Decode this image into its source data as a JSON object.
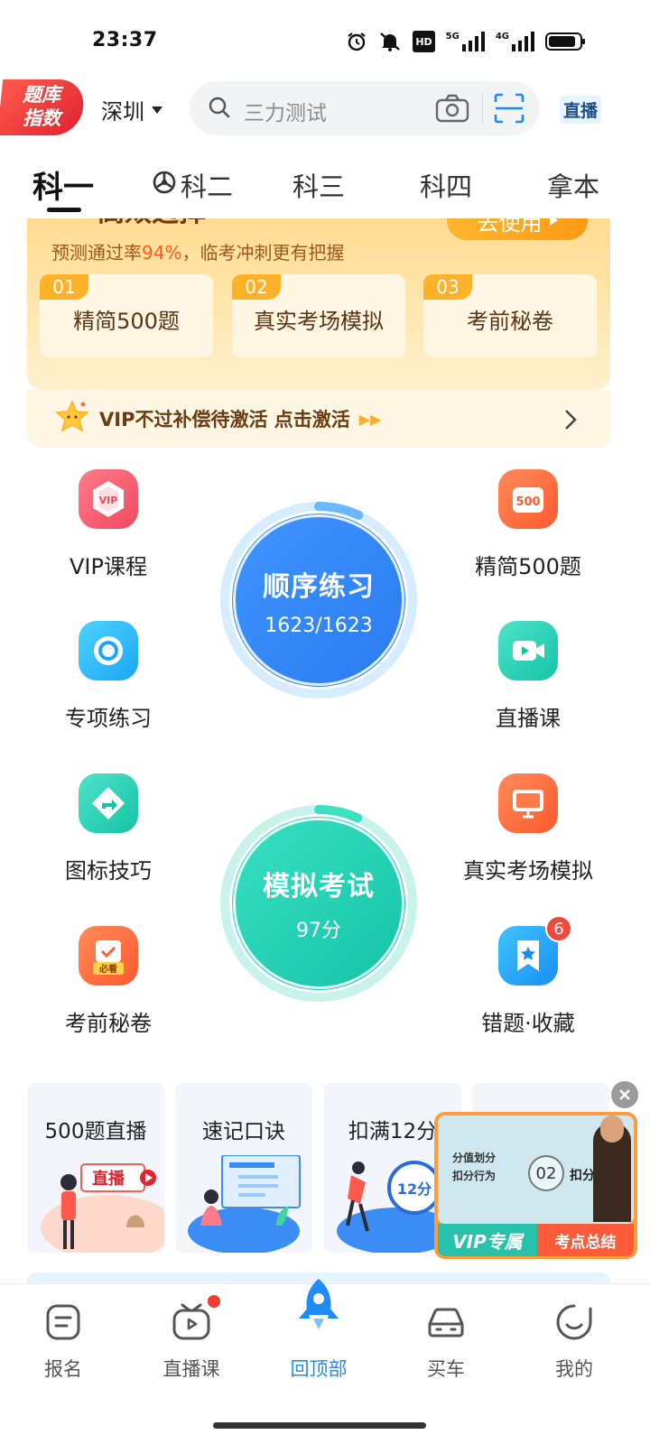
{
  "status": {
    "time": "23:37",
    "hd_label": "HD",
    "net1": "5G",
    "net2": "4G"
  },
  "header": {
    "logo_line1": "题库",
    "logo_line2": "指数",
    "city": "深圳",
    "search_placeholder": "三力测试",
    "live_badge": "直播"
  },
  "tabs": [
    {
      "label": "科一",
      "active": true
    },
    {
      "label": "科二",
      "active": false
    },
    {
      "label": "科三",
      "active": false
    },
    {
      "label": "科四",
      "active": false
    },
    {
      "label": "拿本",
      "active": false
    }
  ],
  "promo": {
    "title": "高效选择",
    "subtitle_prefix": "预测通过率",
    "subtitle_rate": "94%",
    "subtitle_suffix": "，临考冲刺更有把握",
    "use_button": "去使用",
    "items": [
      {
        "num": "01",
        "label": "精简500题"
      },
      {
        "num": "02",
        "label": "真实考场模拟"
      },
      {
        "num": "03",
        "label": "考前秘卷"
      }
    ]
  },
  "vip_bar": {
    "text": "VIP不过补偿待激活 点击激活",
    "arrows": "▶▶"
  },
  "features": [
    {
      "label": "VIP课程",
      "icon": "vip-icon"
    },
    {
      "label": "精简500题",
      "icon": "500-icon",
      "icon_text": "500"
    },
    {
      "label": "专项练习",
      "icon": "target-icon"
    },
    {
      "label": "直播课",
      "icon": "video-icon"
    },
    {
      "label": "图标技巧",
      "icon": "sign-icon"
    },
    {
      "label": "真实考场模拟",
      "icon": "monitor-icon"
    },
    {
      "label": "考前秘卷",
      "icon": "must-see-icon",
      "icon_text": "必看"
    },
    {
      "label": "错题·收藏",
      "icon": "bookmark-icon",
      "badge": "6"
    }
  ],
  "rings": {
    "practice": {
      "title": "顺序练习",
      "value": "1623/1623",
      "progress": 1.0,
      "color": "#2f93f5"
    },
    "exam": {
      "title": "模拟考试",
      "value": "97分",
      "progress": 0.97,
      "color": "#22d3b0"
    }
  },
  "live_cards": [
    {
      "title": "500题直播",
      "art_text": "直播"
    },
    {
      "title": "速记口诀"
    },
    {
      "title": "扣满12分",
      "art_text": "12分"
    }
  ],
  "video": {
    "line1": "分值划分",
    "line2": "扣分行为",
    "num": "02",
    "topic": "扣分分值",
    "vip_label": "VIP专属",
    "summary_label": "考点总结"
  },
  "bottom_nav": [
    {
      "label": "报名",
      "icon": "signup-icon"
    },
    {
      "label": "直播课",
      "icon": "tv-icon",
      "dot": true
    },
    {
      "label": "回顶部",
      "icon": "rocket-icon",
      "active": true
    },
    {
      "label": "买车",
      "icon": "car-icon"
    },
    {
      "label": "我的",
      "icon": "profile-icon"
    }
  ],
  "colors": {
    "accent_blue": "#1f8cf5",
    "accent_teal": "#22d3b0",
    "promo_orange": "#ffb12a",
    "logo_red": "#e0232f"
  }
}
